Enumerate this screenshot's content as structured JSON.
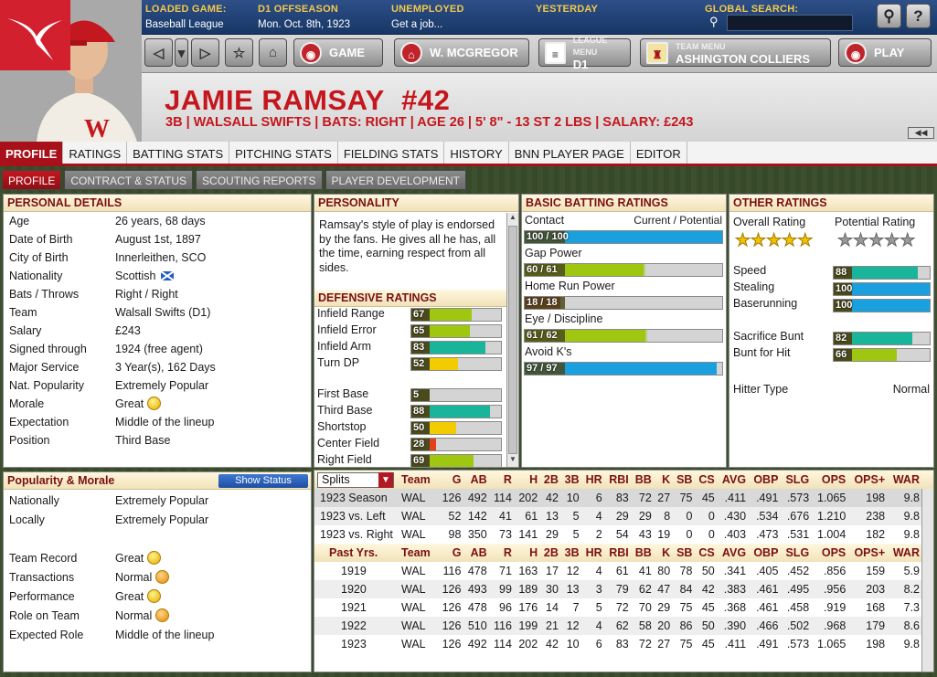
{
  "topbar": {
    "loaded_game_label": "LOADED GAME:",
    "loaded_game": "Baseball League",
    "season_label": "D1 OFFSEASON",
    "season_date": "Mon. Oct. 8th, 1923",
    "status_label": "UNEMPLOYED",
    "status_text": "Get a job...",
    "yesterday_label": "YESTERDAY",
    "search_label": "GLOBAL SEARCH:"
  },
  "nav": {
    "game": "GAME",
    "manager": "W. MCGREGOR",
    "league_menu_label": "LEAGUE MENU",
    "league": "D1",
    "team_menu_label": "TEAM MENU",
    "team": "ASHINGTON COLLIERS",
    "play": "PLAY"
  },
  "player": {
    "name": "JAMIE RAMSAY",
    "number": "#42",
    "info": "3B | WALSALL SWIFTS | BATS: RIGHT | AGE 26 | 5' 8\" - 13 ST 2 LBS | SALARY: £243"
  },
  "tabs": [
    "PROFILE",
    "RATINGS",
    "BATTING STATS",
    "PITCHING STATS",
    "FIELDING STATS",
    "HISTORY",
    "BNN PLAYER PAGE",
    "EDITOR"
  ],
  "subtabs": [
    "PROFILE",
    "CONTRACT & STATUS",
    "SCOUTING REPORTS",
    "PLAYER DEVELOPMENT"
  ],
  "personal": {
    "title": "PERSONAL DETAILS",
    "rows": [
      {
        "k": "Age",
        "v": "26 years, 68 days"
      },
      {
        "k": "Date of Birth",
        "v": "August 1st, 1897"
      },
      {
        "k": "City of Birth",
        "v": "Innerleithen, SCO"
      },
      {
        "k": "Nationality",
        "v": "Scottish"
      },
      {
        "k": "Bats / Throws",
        "v": "Right / Right"
      },
      {
        "k": "Team",
        "v": "Walsall Swifts (D1)"
      },
      {
        "k": "Salary",
        "v": "£243"
      },
      {
        "k": "Signed through",
        "v": "1924 (free agent)"
      },
      {
        "k": "Major Service",
        "v": "3 Year(s), 162 Days"
      },
      {
        "k": "Nat. Popularity",
        "v": "Extremely Popular"
      },
      {
        "k": "Morale",
        "v": "Great"
      },
      {
        "k": "Expectation",
        "v": "Middle of the lineup"
      },
      {
        "k": "Position",
        "v": "Third Base"
      }
    ]
  },
  "popularity": {
    "title": "Popularity & Morale",
    "button": "Show Status",
    "rows": [
      {
        "k": "Nationally",
        "v": "Extremely Popular"
      },
      {
        "k": "Locally",
        "v": "Extremely Popular"
      },
      {
        "k": "Team Record",
        "v": "Great"
      },
      {
        "k": "Transactions",
        "v": "Normal"
      },
      {
        "k": "Performance",
        "v": "Great"
      },
      {
        "k": "Role on Team",
        "v": "Normal"
      },
      {
        "k": "Expected Role",
        "v": "Middle of the lineup"
      }
    ]
  },
  "personality": {
    "title": "PERSONALITY",
    "text": "Ramsay's style of play is endorsed by the fans. He gives all he has, all the time, earning respect from all sides."
  },
  "defense": {
    "title": "DEFENSIVE RATINGS",
    "items": [
      {
        "k": "Infield Range",
        "v": 67,
        "color": "#9fc711"
      },
      {
        "k": "Infield Error",
        "v": 65,
        "color": "#9fc711"
      },
      {
        "k": "Infield Arm",
        "v": 83,
        "color": "#19b59a"
      },
      {
        "k": "Turn DP",
        "v": 52,
        "color": "#f2cc00"
      },
      {
        "k": "First Base",
        "v": 5,
        "color": "#8b0d12"
      },
      {
        "k": "Third Base",
        "v": 88,
        "color": "#19b59a"
      },
      {
        "k": "Shortstop",
        "v": 50,
        "color": "#f2cc00"
      },
      {
        "k": "Center Field",
        "v": 28,
        "color": "#e3411a"
      },
      {
        "k": "Right Field",
        "v": 69,
        "color": "#9fc711"
      }
    ]
  },
  "batting": {
    "title": "BASIC BATTING RATINGS",
    "col1": "Contact",
    "col2": "Current / Potential",
    "items": [
      {
        "k": "Contact",
        "cur": 100,
        "pot": 100,
        "label": "100 / 100",
        "color": "#1aa0de"
      },
      {
        "k": "Gap Power",
        "cur": 60,
        "pot": 61,
        "label": "60 / 61",
        "color": "#9fc711"
      },
      {
        "k": "Home Run Power",
        "cur": 18,
        "pot": 18,
        "label": "18 / 18",
        "color": "#c0141c"
      },
      {
        "k": "Eye / Discipline",
        "cur": 61,
        "pot": 62,
        "label": "61 / 62",
        "color": "#9fc711"
      },
      {
        "k": "Avoid K's",
        "cur": 97,
        "pot": 97,
        "label": "97 / 97",
        "color": "#1aa0de"
      }
    ]
  },
  "other": {
    "title": "OTHER RATINGS",
    "overall_label": "Overall Rating",
    "potential_label": "Potential Rating",
    "overall_stars": 5,
    "potential_stars": 0,
    "items": [
      {
        "k": "Speed",
        "v": 88,
        "color": "#19b59a"
      },
      {
        "k": "Stealing",
        "v": 100,
        "color": "#1aa0de"
      },
      {
        "k": "Baserunning",
        "v": 100,
        "color": "#1aa0de"
      },
      {
        "k": "Sacrifice Bunt",
        "v": 82,
        "color": "#19b59a"
      },
      {
        "k": "Bunt for Hit",
        "v": 66,
        "color": "#9fc711"
      }
    ],
    "hitter_type_label": "Hitter Type",
    "hitter_type": "Normal"
  },
  "stats": {
    "splits_label": "Splits",
    "past_label": "Past Yrs.",
    "columns": [
      "Team",
      "G",
      "AB",
      "R",
      "H",
      "2B",
      "3B",
      "HR",
      "RBI",
      "BB",
      "K",
      "SB",
      "CS",
      "AVG",
      "OBP",
      "SLG",
      "OPS",
      "OPS+",
      "WAR"
    ],
    "splits": [
      [
        "1923 Season",
        "WAL",
        "126",
        "492",
        "114",
        "202",
        "42",
        "10",
        "6",
        "83",
        "72",
        "27",
        "75",
        "45",
        ".411",
        ".491",
        ".573",
        "1.065",
        "198",
        "9.8"
      ],
      [
        "1923 vs. Left",
        "WAL",
        "52",
        "142",
        "41",
        "61",
        "13",
        "5",
        "4",
        "29",
        "29",
        "8",
        "0",
        "0",
        ".430",
        ".534",
        ".676",
        "1.210",
        "238",
        "9.8"
      ],
      [
        "1923 vs. Right",
        "WAL",
        "98",
        "350",
        "73",
        "141",
        "29",
        "5",
        "2",
        "54",
        "43",
        "19",
        "0",
        "0",
        ".403",
        ".473",
        ".531",
        "1.004",
        "182",
        "9.8"
      ]
    ],
    "past": [
      [
        "1919",
        "WAL",
        "116",
        "478",
        "71",
        "163",
        "17",
        "12",
        "4",
        "61",
        "41",
        "80",
        "78",
        "50",
        ".341",
        ".405",
        ".452",
        ".856",
        "159",
        "5.9"
      ],
      [
        "1920",
        "WAL",
        "126",
        "493",
        "99",
        "189",
        "30",
        "13",
        "3",
        "79",
        "62",
        "47",
        "84",
        "42",
        ".383",
        ".461",
        ".495",
        ".956",
        "203",
        "8.2"
      ],
      [
        "1921",
        "WAL",
        "126",
        "478",
        "96",
        "176",
        "14",
        "7",
        "5",
        "72",
        "70",
        "29",
        "75",
        "45",
        ".368",
        ".461",
        ".458",
        ".919",
        "168",
        "7.3"
      ],
      [
        "1922",
        "WAL",
        "126",
        "510",
        "116",
        "199",
        "21",
        "12",
        "4",
        "62",
        "58",
        "20",
        "86",
        "50",
        ".390",
        ".466",
        ".502",
        ".968",
        "179",
        "8.6"
      ],
      [
        "1923",
        "WAL",
        "126",
        "492",
        "114",
        "202",
        "42",
        "10",
        "6",
        "83",
        "72",
        "27",
        "75",
        "45",
        ".411",
        ".491",
        ".573",
        "1.065",
        "198",
        "9.8"
      ]
    ]
  },
  "colors": {
    "accent": "#a8101a",
    "header_blue": "#173766"
  }
}
